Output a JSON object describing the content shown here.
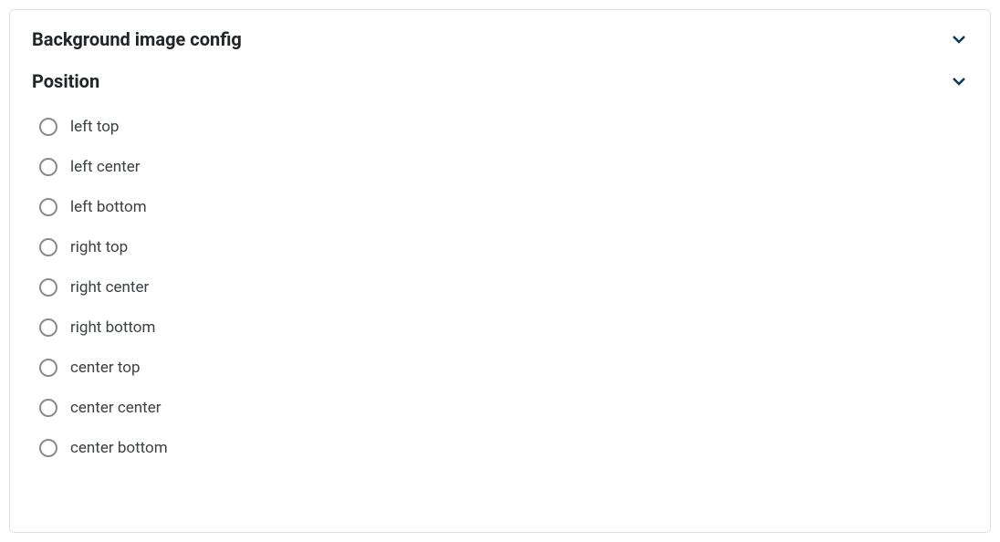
{
  "sections": {
    "main": {
      "title": "Background image config"
    },
    "position": {
      "title": "Position",
      "options": [
        "left top",
        "left center",
        "left bottom",
        "right top",
        "right center",
        "right bottom",
        "center top",
        "center center",
        "center bottom"
      ]
    }
  }
}
